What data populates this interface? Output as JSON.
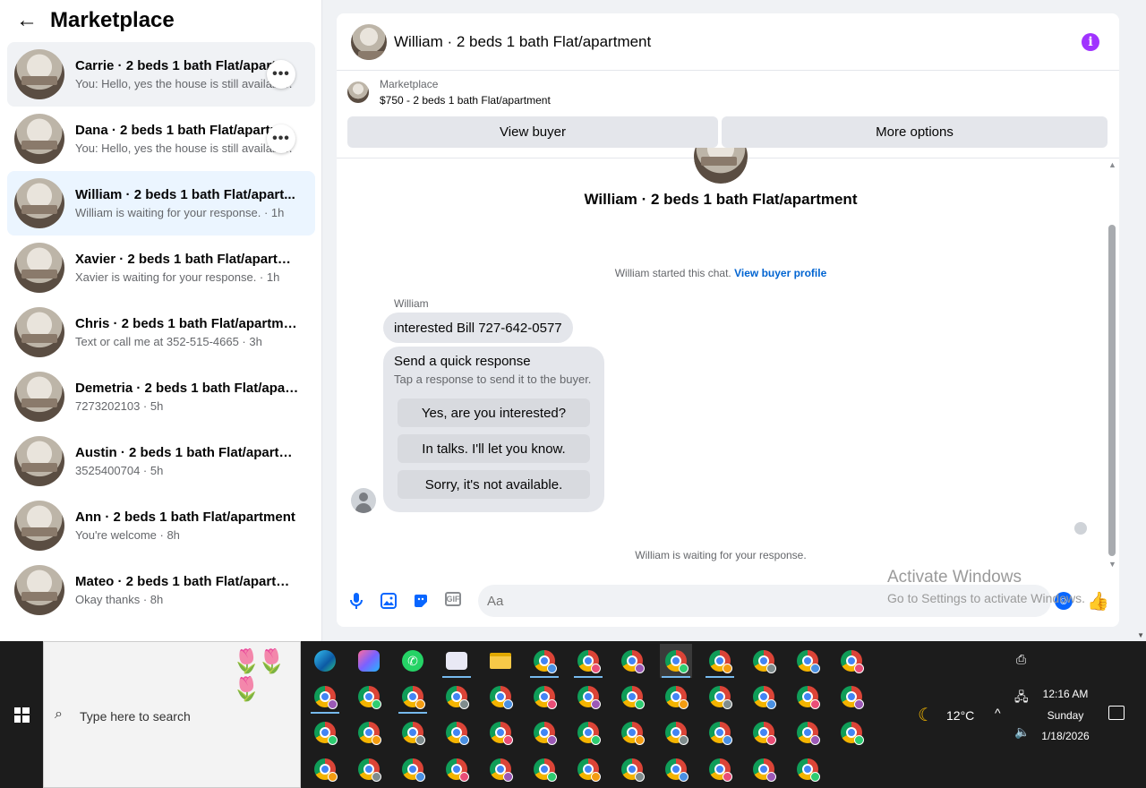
{
  "sidebar": {
    "title": "Marketplace",
    "conversations": [
      {
        "name": "Carrie · 2 beds 1 bath Flat/apartment",
        "preview": "You: Hello, yes the house is still available · 1h"
      },
      {
        "name": "Dana · 2 beds 1 bath Flat/apartment",
        "preview": "You: Hello, yes the house is still available · 1h"
      },
      {
        "name": "William · 2 beds 1 bath Flat/apart...",
        "preview": "William is waiting for your response. · 1h"
      },
      {
        "name": "Xavier · 2 beds 1 bath Flat/apartm...",
        "preview": "Xavier is waiting for your response. · 1h"
      },
      {
        "name": "Chris · 2 beds 1 bath Flat/apartment",
        "preview": "Text or call me at 352-515-4665 · 3h"
      },
      {
        "name": "Demetria · 2 beds 1 bath Flat/apart...",
        "preview": "7273202103 · 5h"
      },
      {
        "name": "Austin · 2 beds 1 bath Flat/apartm...",
        "preview": "3525400704 · 5h"
      },
      {
        "name": "Ann · 2 beds 1 bath Flat/apartment",
        "preview": "You're welcome · 8h"
      },
      {
        "name": "Mateo · 2 beds 1 bath Flat/apartm...",
        "preview": "Okay thanks · 8h"
      }
    ],
    "more_glyph": "•••"
  },
  "chat": {
    "header_title": "William · 2 beds 1 bath Flat/apartment",
    "info_glyph": "i",
    "listing_label": "Marketplace",
    "listing_price": "$750 - 2 beds 1 bath Flat/apartment",
    "view_buyer": "View buyer",
    "more_options": "More options",
    "heading": "William · 2 beds 1 bath Flat/apartment",
    "started_text": "William started this chat.",
    "view_profile": "View buyer profile",
    "sender": "William",
    "message": "interested Bill 727-642-0577",
    "quick_title": "Send a quick response",
    "quick_sub": "Tap a response to send it to the buyer.",
    "quick_replies": [
      "Yes, are you interested?",
      "In talks. I'll let you know.",
      "Sorry, it's not available."
    ],
    "waiting": "William is waiting for your response.",
    "input_placeholder": "Aa",
    "gif_label": "GIF"
  },
  "watermark": {
    "line1": "Activate Windows",
    "line2": "Go to Settings to activate Windows."
  },
  "taskbar": {
    "search_placeholder": "Type here to search",
    "temperature": "12°C",
    "time": "12:16 AM",
    "day": "Sunday",
    "date": "1/18/2026"
  },
  "colors": {
    "accent": "#0866ff",
    "info": "#a033ff",
    "link": "#0064d1",
    "active_row": "#ebf5ff"
  }
}
